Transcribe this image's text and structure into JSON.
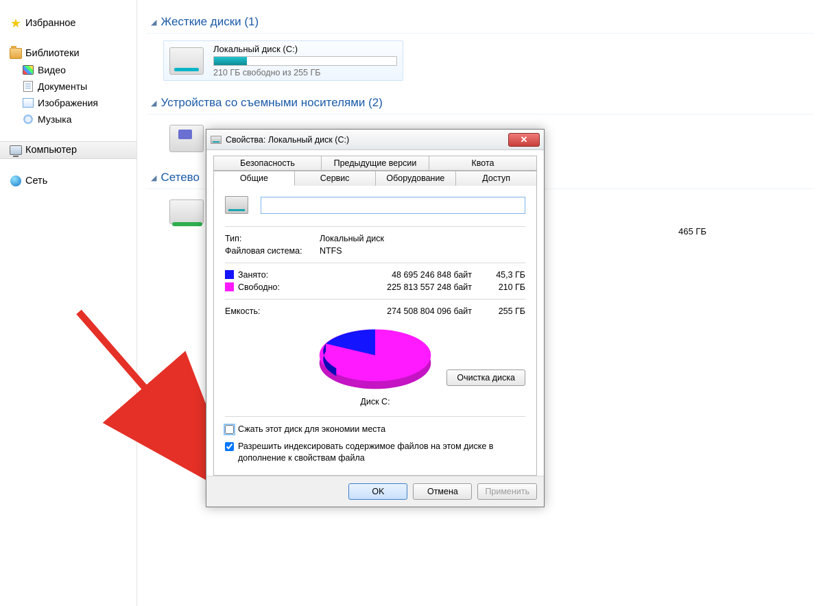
{
  "nav": {
    "favorites": "Избранное",
    "libraries": "Библиотеки",
    "video": "Видео",
    "documents": "Документы",
    "images": "Изображения",
    "music": "Музыка",
    "computer": "Компьютер",
    "network": "Сеть"
  },
  "categories": {
    "hdd": "Жесткие диски (1)",
    "removable": "Устройства со съемными носителями (2)",
    "netloc": "Сетево"
  },
  "drive": {
    "name": "Локальный диск (C:)",
    "free_line": "210 ГБ свободно из 255 ГБ",
    "fill_percent": 18
  },
  "remote_tail": "465 ГБ",
  "dialog": {
    "title": "Свойства: Локальный диск (C:)",
    "tabs_top": [
      "Безопасность",
      "Предыдущие версии",
      "Квота"
    ],
    "tabs_bottom": [
      "Общие",
      "Сервис",
      "Оборудование",
      "Доступ"
    ],
    "name_value": "",
    "type_label": "Тип:",
    "type_value": "Локальный диск",
    "fs_label": "Файловая система:",
    "fs_value": "NTFS",
    "used_label": "Занято:",
    "used_bytes": "48 695 246 848 байт",
    "used_h": "45,3 ГБ",
    "free_label": "Свободно:",
    "free_bytes": "225 813 557 248 байт",
    "free_h": "210 ГБ",
    "cap_label": "Емкость:",
    "cap_bytes": "274 508 804 096 байт",
    "cap_h": "255 ГБ",
    "disk_label": "Диск C:",
    "clean_btn": "Очистка диска",
    "compress": "Сжать этот диск для экономии места",
    "index": "Разрешить индексировать содержимое файлов на этом диске в дополнение к свойствам файла",
    "ok": "OK",
    "cancel": "Отмена",
    "apply": "Применить"
  },
  "chart_data": {
    "type": "pie",
    "title": "Диск C:",
    "series": [
      {
        "name": "Занято",
        "value": 48695246848,
        "value_h": "45,3 ГБ",
        "color": "#1414ff"
      },
      {
        "name": "Свободно",
        "value": 225813557248,
        "value_h": "210 ГБ",
        "color": "#ff1aff"
      }
    ],
    "total": 274508804096,
    "total_h": "255 ГБ"
  }
}
